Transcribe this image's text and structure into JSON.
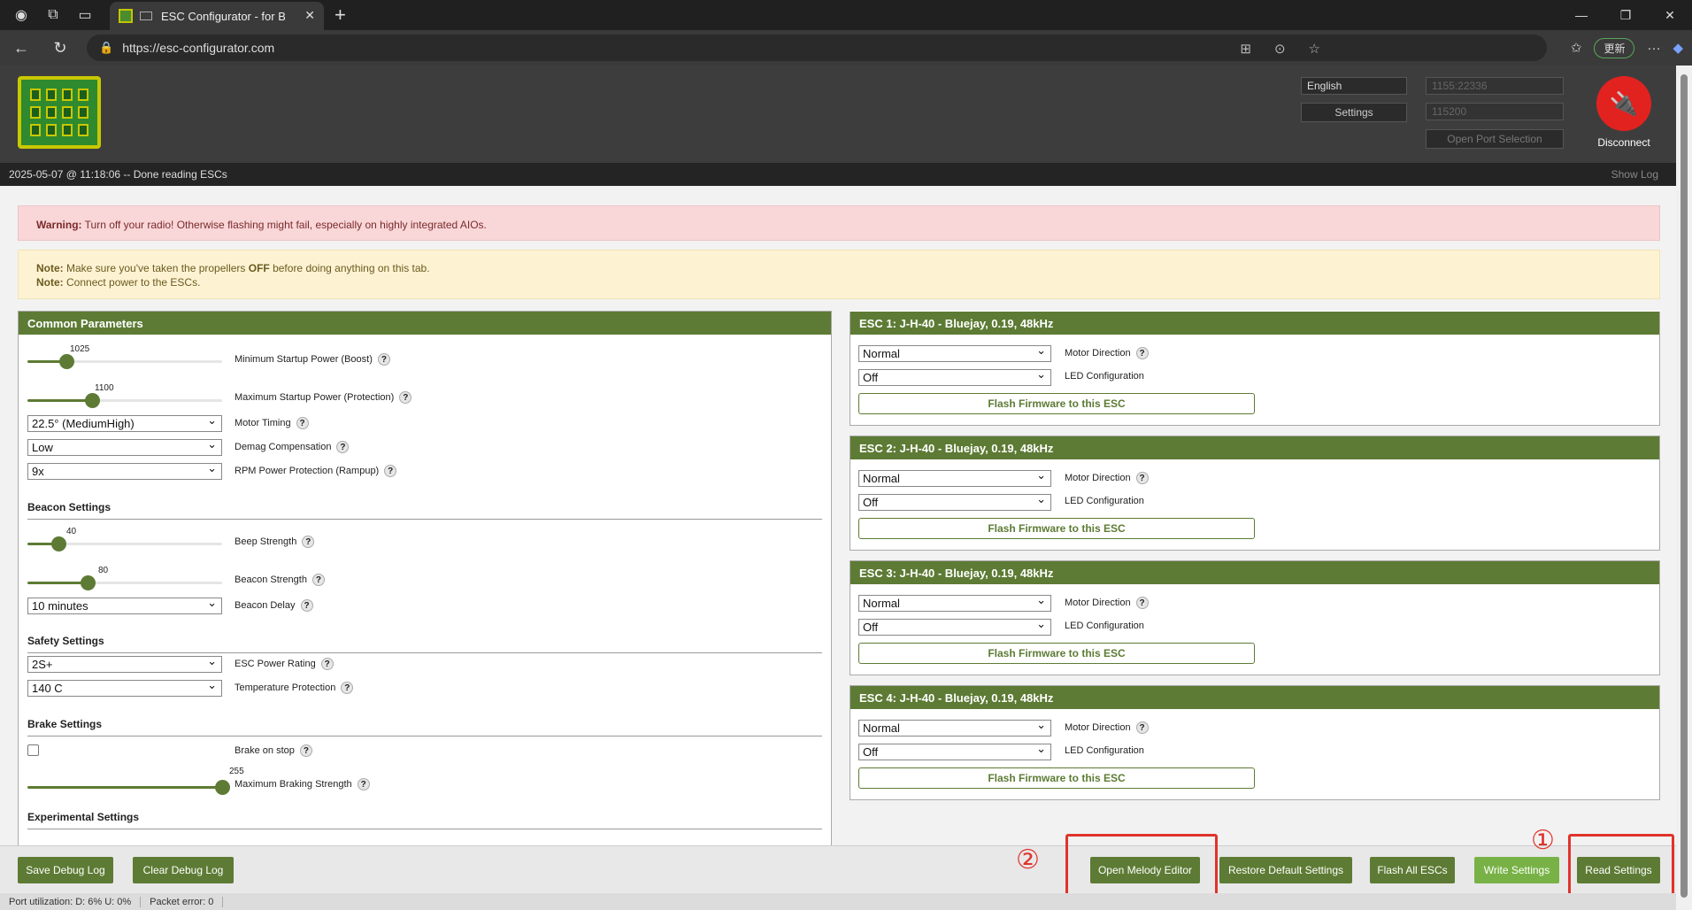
{
  "browser": {
    "tab_title": "ESC Configurator - for Bluejay",
    "url": "https://esc-configurator.com",
    "update_label": "更新"
  },
  "header": {
    "language": "English",
    "settings_label": "Settings",
    "port": "1155:22336",
    "baud": "115200",
    "open_port_label": "Open Port Selection",
    "disconnect_label": "Disconnect"
  },
  "log": {
    "line": "2025-05-07 @ 11:18:06 -- Done reading ESCs",
    "show_log": "Show Log"
  },
  "alerts": {
    "warning_title": "Warning:",
    "warning_text": " Turn off your radio! Otherwise flashing might fail, especially on highly integrated AIOs.",
    "note1_title": "Note:",
    "note1_text_a": " Make sure you've taken the propellers ",
    "note1_bold": "OFF",
    "note1_text_b": " before doing anything on this tab.",
    "note2_title": "Note:",
    "note2_text": " Connect power to the ESCs."
  },
  "common": {
    "title": "Common Parameters",
    "min_startup": {
      "value": "1025",
      "label": "Minimum Startup Power (Boost)",
      "fraction": 0.2
    },
    "max_startup": {
      "value": "1100",
      "label": "Maximum Startup Power (Protection)",
      "fraction": 0.33
    },
    "motor_timing": {
      "value": "22.5° (MediumHigh)",
      "label": "Motor Timing"
    },
    "demag": {
      "value": "Low",
      "label": "Demag Compensation"
    },
    "rpm_power": {
      "value": "9x",
      "label": "RPM Power Protection (Rampup)"
    },
    "beacon_section": "Beacon Settings",
    "beep": {
      "value": "40",
      "label": "Beep Strength",
      "fraction": 0.16
    },
    "beacon_strength": {
      "value": "80",
      "label": "Beacon Strength",
      "fraction": 0.31
    },
    "beacon_delay": {
      "value": "10 minutes",
      "label": "Beacon Delay"
    },
    "safety_section": "Safety Settings",
    "power_rating": {
      "value": "2S+",
      "label": "ESC Power Rating"
    },
    "temp": {
      "value": "140 C",
      "label": "Temperature Protection"
    },
    "brake_section": "Brake Settings",
    "brake_stop": {
      "label": "Brake on stop"
    },
    "max_braking": {
      "value": "255",
      "label": "Maximum Braking Strength",
      "fraction": 1.0
    },
    "experimental_section": "Experimental Settings"
  },
  "escs": [
    {
      "title": "ESC 1: J-H-40 - Bluejay, 0.19, 48kHz",
      "direction": "Normal",
      "led": "Off"
    },
    {
      "title": "ESC 2: J-H-40 - Bluejay, 0.19, 48kHz",
      "direction": "Normal",
      "led": "Off"
    },
    {
      "title": "ESC 3: J-H-40 - Bluejay, 0.19, 48kHz",
      "direction": "Normal",
      "led": "Off"
    },
    {
      "title": "ESC 4: J-H-40 - Bluejay, 0.19, 48kHz",
      "direction": "Normal",
      "led": "Off"
    }
  ],
  "esc_labels": {
    "direction": "Motor Direction",
    "led": "LED Configuration",
    "flash": "Flash Firmware to this ESC"
  },
  "bottom": {
    "save_debug": "Save Debug Log",
    "clear_debug": "Clear Debug Log",
    "melody": "Open Melody Editor",
    "restore": "Restore Default Settings",
    "flash_all": "Flash All ESCs",
    "write": "Write Settings",
    "read": "Read Settings",
    "marker1": "①",
    "marker2": "②"
  },
  "status": {
    "port_util": "Port utilization: D: 6% U: 0%",
    "packet_error": "Packet error: 0"
  }
}
